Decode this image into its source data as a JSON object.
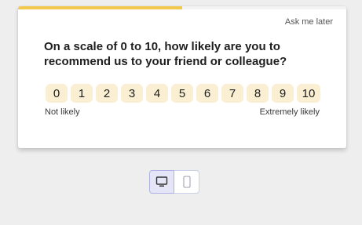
{
  "survey": {
    "ask_later": "Ask me later",
    "question": "On a scale of 0 to 10, how likely are you to recommend us to your friend or colleague?",
    "progress": 0.5,
    "progress_color": "#f2c94c",
    "scale_color": "#fbefd3",
    "scale": [
      "0",
      "1",
      "2",
      "3",
      "4",
      "5",
      "6",
      "7",
      "8",
      "9",
      "10"
    ],
    "label_low": "Not likely",
    "label_high": "Extremely likely"
  },
  "preview": {
    "devices": [
      {
        "icon": "desktop-icon",
        "selected": true
      },
      {
        "icon": "mobile-icon",
        "selected": false
      }
    ]
  }
}
